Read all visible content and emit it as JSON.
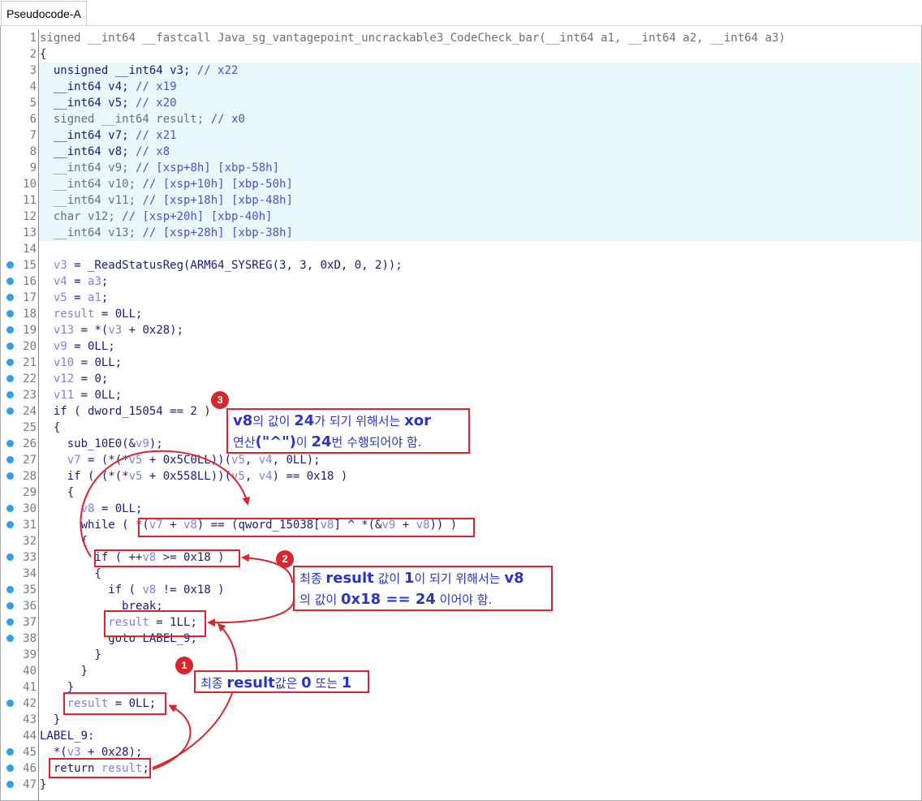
{
  "tab": {
    "title": "Pseudocode-A"
  },
  "lines": [
    {
      "n": "1",
      "bp": false,
      "hl": false,
      "indent": 0,
      "tokens": [
        [
          "g",
          "signed __int64 __fastcall Java_sg_vantagepoint_uncrackable3_CodeCheck_bar(__int64 a1, __int64 a2, __int64 a3)"
        ]
      ]
    },
    {
      "n": "2",
      "bp": false,
      "hl": false,
      "indent": 0,
      "tokens": [
        [
          "k",
          "{"
        ]
      ]
    },
    {
      "n": "3",
      "bp": false,
      "hl": true,
      "indent": 2,
      "tokens": [
        [
          "k",
          "unsigned __int64 v3; "
        ],
        [
          "c",
          "// x22"
        ]
      ]
    },
    {
      "n": "4",
      "bp": false,
      "hl": true,
      "indent": 2,
      "tokens": [
        [
          "k",
          "__int64 v4; "
        ],
        [
          "c",
          "// x19"
        ]
      ]
    },
    {
      "n": "5",
      "bp": false,
      "hl": true,
      "indent": 2,
      "tokens": [
        [
          "k",
          "__int64 v5; "
        ],
        [
          "c",
          "// x20"
        ]
      ]
    },
    {
      "n": "6",
      "bp": false,
      "hl": true,
      "indent": 2,
      "tokens": [
        [
          "g",
          "signed __int64 result; "
        ],
        [
          "c",
          "// x0"
        ]
      ]
    },
    {
      "n": "7",
      "bp": false,
      "hl": true,
      "indent": 2,
      "tokens": [
        [
          "k",
          "__int64 v7; "
        ],
        [
          "c",
          "// x21"
        ]
      ]
    },
    {
      "n": "8",
      "bp": false,
      "hl": true,
      "indent": 2,
      "tokens": [
        [
          "k",
          "__int64 v8; "
        ],
        [
          "c",
          "// x8"
        ]
      ]
    },
    {
      "n": "9",
      "bp": false,
      "hl": true,
      "indent": 2,
      "tokens": [
        [
          "g",
          "__int64 v9; "
        ],
        [
          "c",
          "// [xsp+8h] [xbp-58h]"
        ]
      ]
    },
    {
      "n": "10",
      "bp": false,
      "hl": true,
      "indent": 2,
      "tokens": [
        [
          "g",
          "__int64 v10; "
        ],
        [
          "c",
          "// [xsp+10h] [xbp-50h]"
        ]
      ]
    },
    {
      "n": "11",
      "bp": false,
      "hl": true,
      "indent": 2,
      "tokens": [
        [
          "g",
          "__int64 v11; "
        ],
        [
          "c",
          "// [xsp+18h] [xbp-48h]"
        ]
      ]
    },
    {
      "n": "12",
      "bp": false,
      "hl": true,
      "indent": 2,
      "tokens": [
        [
          "g",
          "char v12; "
        ],
        [
          "c",
          "// [xsp+20h] [xbp-40h]"
        ]
      ]
    },
    {
      "n": "13",
      "bp": false,
      "hl": true,
      "indent": 2,
      "tokens": [
        [
          "g",
          "__int64 v13; "
        ],
        [
          "c",
          "// [xsp+28h] [xbp-38h]"
        ]
      ]
    },
    {
      "n": "14",
      "bp": false,
      "hl": false,
      "indent": 0,
      "tokens": []
    },
    {
      "n": "15",
      "bp": true,
      "hl": false,
      "indent": 2,
      "tokens": [
        [
          "v",
          "v3"
        ],
        [
          "k",
          " = _ReadStatusReg(ARM64_SYSREG(3, 3, 0xD, 0, 2));"
        ]
      ]
    },
    {
      "n": "16",
      "bp": true,
      "hl": false,
      "indent": 2,
      "tokens": [
        [
          "v",
          "v4"
        ],
        [
          "k",
          " = "
        ],
        [
          "v",
          "a3"
        ],
        [
          "k",
          ";"
        ]
      ]
    },
    {
      "n": "17",
      "bp": true,
      "hl": false,
      "indent": 2,
      "tokens": [
        [
          "v",
          "v5"
        ],
        [
          "k",
          " = "
        ],
        [
          "v",
          "a1"
        ],
        [
          "k",
          ";"
        ]
      ]
    },
    {
      "n": "18",
      "bp": true,
      "hl": false,
      "indent": 2,
      "tokens": [
        [
          "v",
          "result"
        ],
        [
          "k",
          " = 0LL;"
        ]
      ]
    },
    {
      "n": "19",
      "bp": true,
      "hl": false,
      "indent": 2,
      "tokens": [
        [
          "v",
          "v13"
        ],
        [
          "k",
          " = *("
        ],
        [
          "v",
          "v3"
        ],
        [
          "k",
          " + 0x28);"
        ]
      ]
    },
    {
      "n": "20",
      "bp": true,
      "hl": false,
      "indent": 2,
      "tokens": [
        [
          "v",
          "v9"
        ],
        [
          "k",
          " = 0LL;"
        ]
      ]
    },
    {
      "n": "21",
      "bp": true,
      "hl": false,
      "indent": 2,
      "tokens": [
        [
          "v",
          "v10"
        ],
        [
          "k",
          " = 0LL;"
        ]
      ]
    },
    {
      "n": "22",
      "bp": true,
      "hl": false,
      "indent": 2,
      "tokens": [
        [
          "v",
          "v12"
        ],
        [
          "k",
          " = 0;"
        ]
      ]
    },
    {
      "n": "23",
      "bp": true,
      "hl": false,
      "indent": 2,
      "tokens": [
        [
          "v",
          "v11"
        ],
        [
          "k",
          " = 0LL;"
        ]
      ]
    },
    {
      "n": "24",
      "bp": true,
      "hl": false,
      "indent": 2,
      "tokens": [
        [
          "k",
          "if ( dword_15054 == 2 )"
        ]
      ]
    },
    {
      "n": "25",
      "bp": false,
      "hl": false,
      "indent": 2,
      "tokens": [
        [
          "k",
          "{"
        ]
      ]
    },
    {
      "n": "26",
      "bp": true,
      "hl": false,
      "indent": 4,
      "tokens": [
        [
          "k",
          "sub_10E0(&"
        ],
        [
          "v",
          "v9"
        ],
        [
          "k",
          ");"
        ]
      ]
    },
    {
      "n": "27",
      "bp": true,
      "hl": false,
      "indent": 4,
      "tokens": [
        [
          "v",
          "v7"
        ],
        [
          "k",
          " = (*(*"
        ],
        [
          "v",
          "v5"
        ],
        [
          "k",
          " + 0x5C0LL))("
        ],
        [
          "v",
          "v5"
        ],
        [
          "k",
          ", "
        ],
        [
          "v",
          "v4"
        ],
        [
          "k",
          ", 0LL);"
        ]
      ]
    },
    {
      "n": "28",
      "bp": true,
      "hl": false,
      "indent": 4,
      "tokens": [
        [
          "k",
          "if ( (*(*"
        ],
        [
          "v",
          "v5"
        ],
        [
          "k",
          " + 0x558LL))("
        ],
        [
          "v",
          "v5"
        ],
        [
          "k",
          ", "
        ],
        [
          "v",
          "v4"
        ],
        [
          "k",
          ") == 0x18 )"
        ]
      ]
    },
    {
      "n": "29",
      "bp": false,
      "hl": false,
      "indent": 4,
      "tokens": [
        [
          "k",
          "{"
        ]
      ]
    },
    {
      "n": "30",
      "bp": true,
      "hl": false,
      "indent": 6,
      "tokens": [
        [
          "v",
          "v8"
        ],
        [
          "k",
          " = 0LL;"
        ]
      ]
    },
    {
      "n": "31",
      "bp": true,
      "hl": false,
      "indent": 6,
      "tokens": [
        [
          "k",
          "while ( *("
        ],
        [
          "v",
          "v7"
        ],
        [
          "k",
          " + "
        ],
        [
          "v",
          "v8"
        ],
        [
          "k",
          ") == (qword_15038["
        ],
        [
          "v",
          "v8"
        ],
        [
          "k",
          "] ^ *(&"
        ],
        [
          "v",
          "v9"
        ],
        [
          "k",
          " + "
        ],
        [
          "v",
          "v8"
        ],
        [
          "k",
          ")) )"
        ]
      ]
    },
    {
      "n": "32",
      "bp": false,
      "hl": false,
      "indent": 6,
      "tokens": [
        [
          "k",
          "{"
        ]
      ]
    },
    {
      "n": "33",
      "bp": true,
      "hl": false,
      "indent": 8,
      "tokens": [
        [
          "k",
          "if ( ++"
        ],
        [
          "v",
          "v8"
        ],
        [
          "k",
          " >= 0x18 )"
        ]
      ]
    },
    {
      "n": "34",
      "bp": false,
      "hl": false,
      "indent": 8,
      "tokens": [
        [
          "k",
          "{"
        ]
      ]
    },
    {
      "n": "35",
      "bp": true,
      "hl": false,
      "indent": 10,
      "tokens": [
        [
          "k",
          "if ( "
        ],
        [
          "v",
          "v8"
        ],
        [
          "k",
          " != 0x18 )"
        ]
      ]
    },
    {
      "n": "36",
      "bp": true,
      "hl": false,
      "indent": 12,
      "tokens": [
        [
          "k",
          "break;"
        ]
      ]
    },
    {
      "n": "37",
      "bp": true,
      "hl": false,
      "indent": 10,
      "tokens": [
        [
          "v",
          "result"
        ],
        [
          "k",
          " = 1LL;"
        ]
      ]
    },
    {
      "n": "38",
      "bp": true,
      "hl": false,
      "indent": 10,
      "tokens": [
        [
          "k",
          "goto LABEL_9;"
        ]
      ]
    },
    {
      "n": "39",
      "bp": false,
      "hl": false,
      "indent": 8,
      "tokens": [
        [
          "k",
          "}"
        ]
      ]
    },
    {
      "n": "40",
      "bp": false,
      "hl": false,
      "indent": 6,
      "tokens": [
        [
          "k",
          "}"
        ]
      ]
    },
    {
      "n": "41",
      "bp": false,
      "hl": false,
      "indent": 4,
      "tokens": [
        [
          "k",
          "}"
        ]
      ]
    },
    {
      "n": "42",
      "bp": true,
      "hl": false,
      "indent": 4,
      "tokens": [
        [
          "v",
          "result"
        ],
        [
          "k",
          " = 0LL;"
        ]
      ]
    },
    {
      "n": "43",
      "bp": false,
      "hl": false,
      "indent": 2,
      "tokens": [
        [
          "k",
          "}"
        ]
      ]
    },
    {
      "n": "44",
      "bp": false,
      "hl": false,
      "indent": 0,
      "tokens": [
        [
          "k",
          "LABEL_9:"
        ]
      ]
    },
    {
      "n": "45",
      "bp": true,
      "hl": false,
      "indent": 2,
      "tokens": [
        [
          "k",
          "*("
        ],
        [
          "v",
          "v3"
        ],
        [
          "k",
          " + 0x28);"
        ]
      ]
    },
    {
      "n": "46",
      "bp": true,
      "hl": false,
      "indent": 2,
      "tokens": [
        [
          "k",
          "return "
        ],
        [
          "v",
          "result"
        ],
        [
          "k",
          ";"
        ]
      ]
    },
    {
      "n": "47",
      "bp": true,
      "hl": false,
      "indent": 0,
      "tokens": [
        [
          "k",
          "}"
        ]
      ]
    }
  ],
  "annotations": {
    "note1": {
      "badge": "1",
      "parts": [
        [
          "최종 ",
          ""
        ],
        [
          "result",
          "b"
        ],
        [
          "값은 ",
          ""
        ],
        [
          "0",
          "b"
        ],
        [
          " 또는 ",
          ""
        ],
        [
          "1",
          "b"
        ]
      ]
    },
    "note2": {
      "badge": "2",
      "line1": [
        [
          "최종 ",
          ""
        ],
        [
          "result",
          "b"
        ],
        [
          " 값이 ",
          ""
        ],
        [
          "1",
          "b"
        ],
        [
          "이 되기 위해서는 ",
          ""
        ],
        [
          "v8",
          "b"
        ]
      ],
      "line2": [
        [
          "의 값이 ",
          ""
        ],
        [
          "0x18 == 24",
          "b"
        ],
        [
          " 이어야 함.",
          ""
        ]
      ]
    },
    "note3": {
      "badge": "3",
      "line1": [
        [
          "v8",
          "b"
        ],
        [
          "의 값이 ",
          ""
        ],
        [
          "24",
          "b"
        ],
        [
          "가 되기 위해서는 ",
          ""
        ],
        [
          "xor",
          "b"
        ]
      ],
      "line2": [
        [
          "연산",
          ""
        ],
        [
          "(\"^\")",
          "b"
        ],
        [
          "이 ",
          ""
        ],
        [
          "24",
          "b"
        ],
        [
          "번 수행되어야 함.",
          ""
        ]
      ]
    }
  },
  "colors": {
    "annotation_red": "#d9252e",
    "annotation_text": "#2a35c8",
    "highlight_bg": "#e7f9fb",
    "breakpoint": "#2e9fe8"
  }
}
